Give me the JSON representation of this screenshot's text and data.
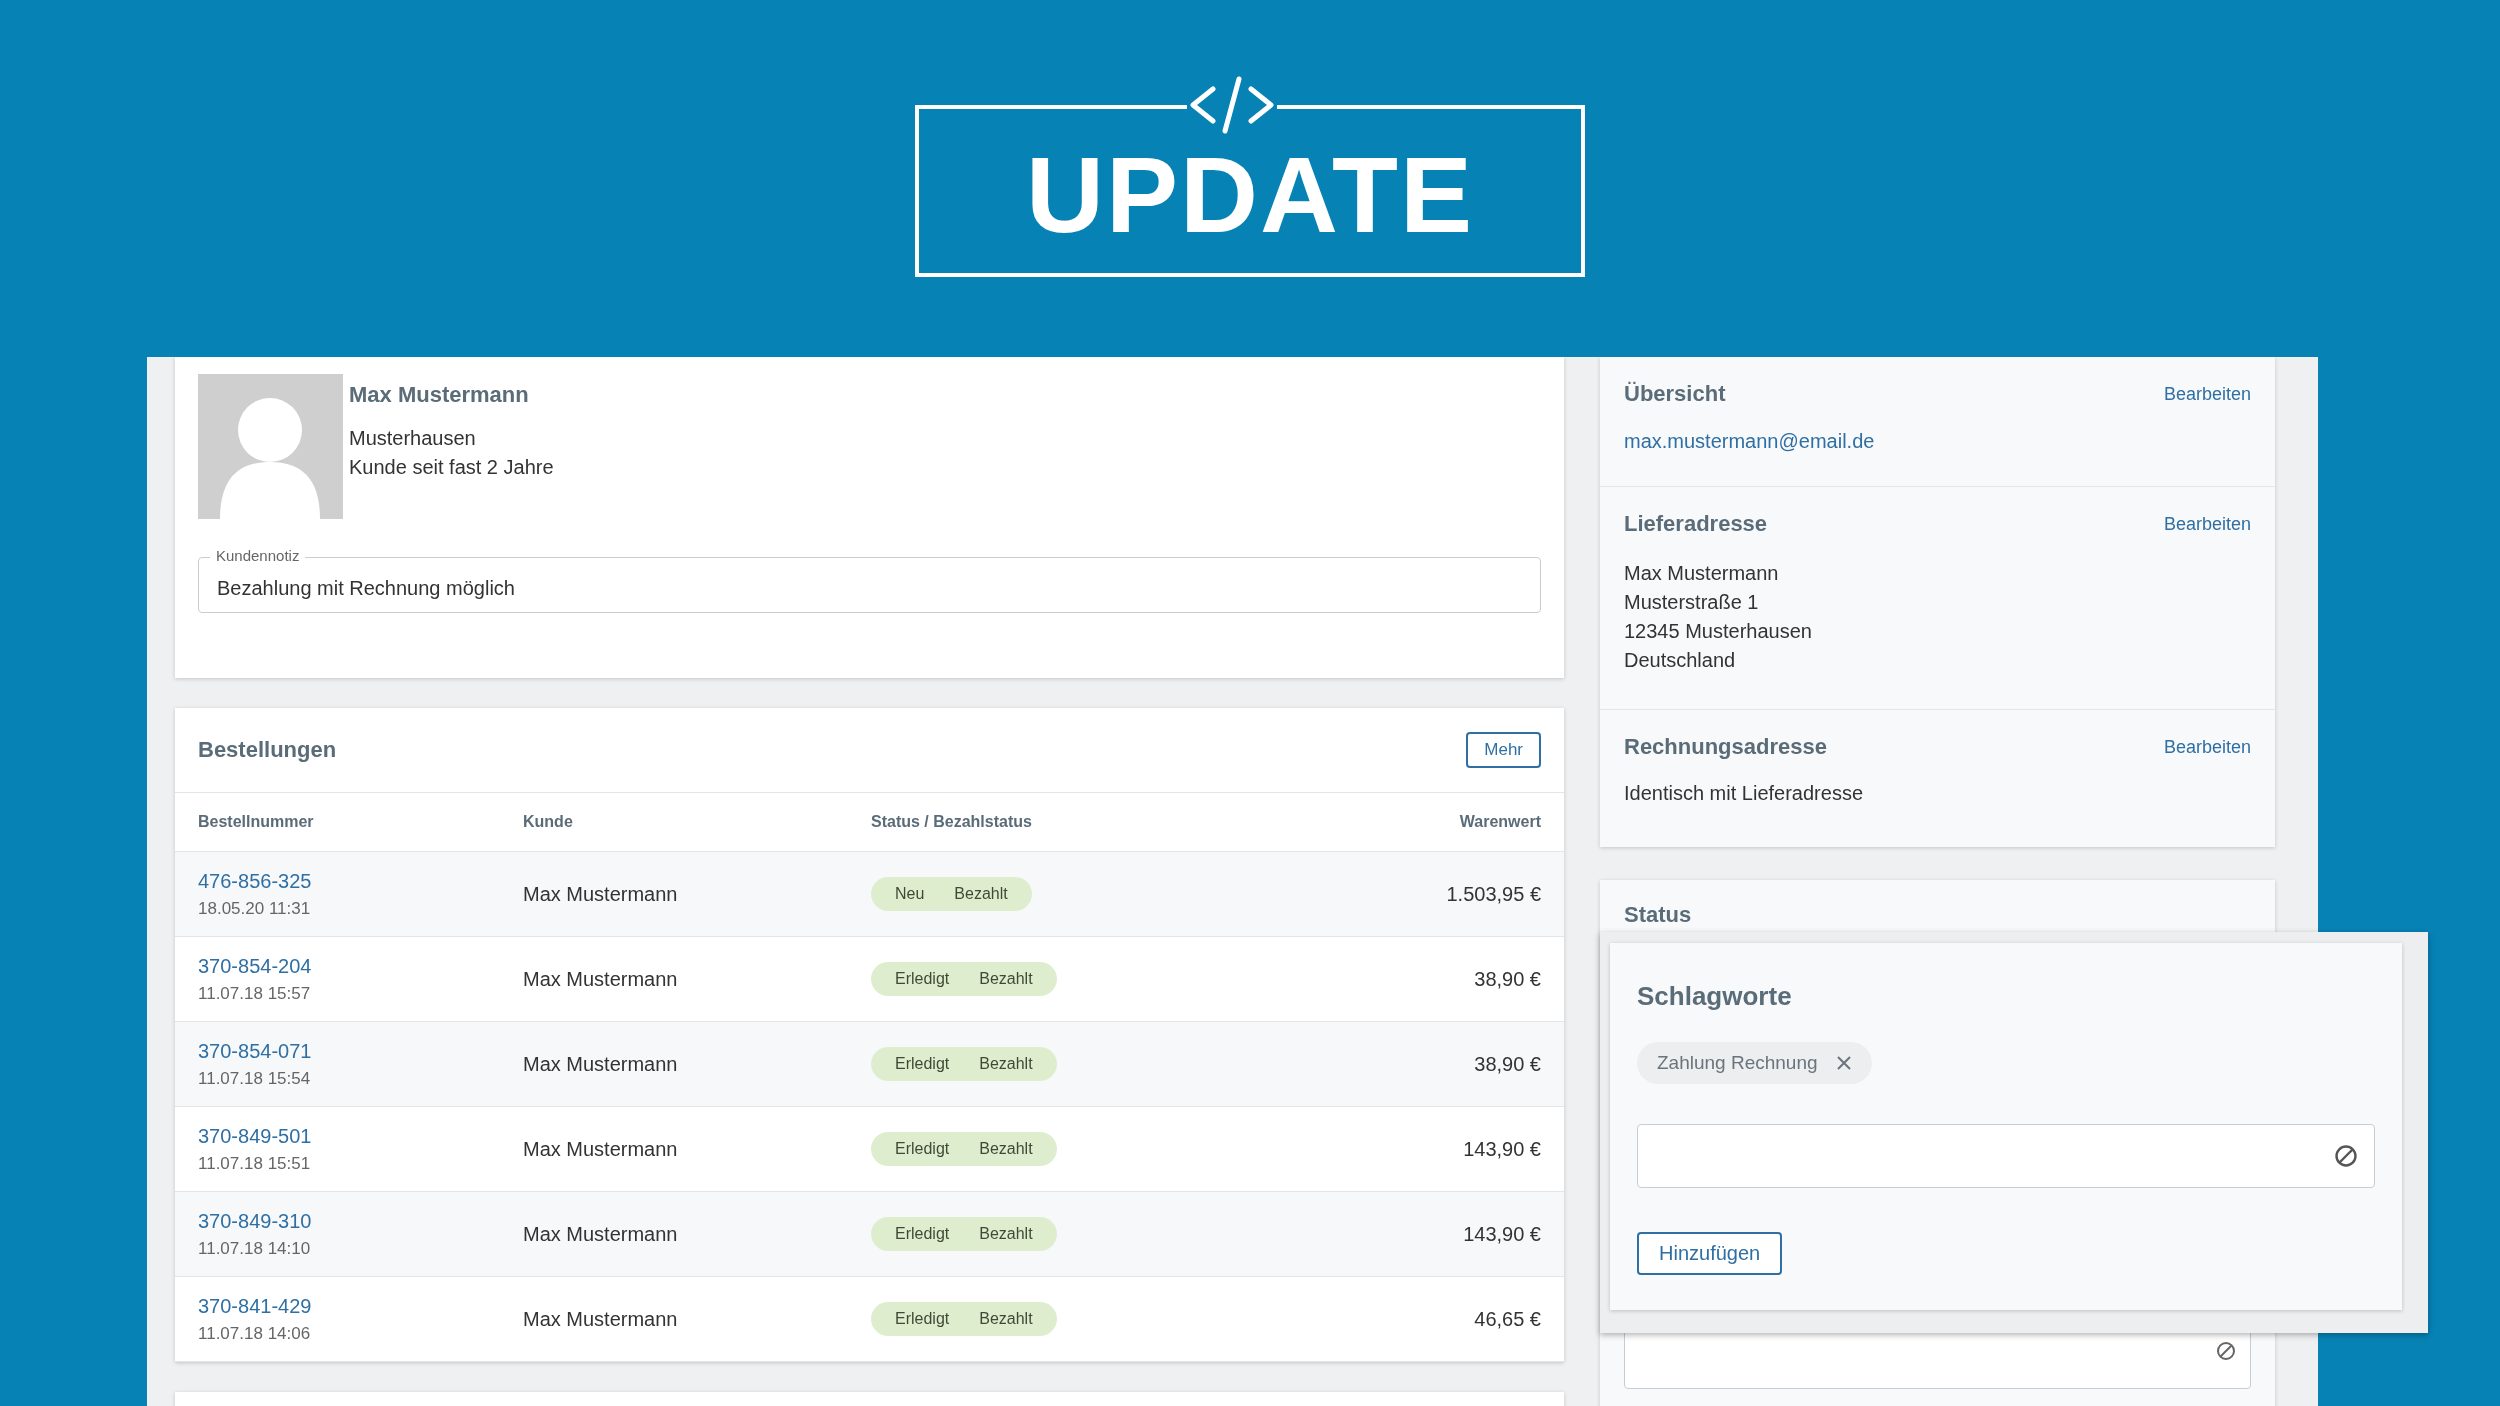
{
  "banner": {
    "title": "UPDATE"
  },
  "customer": {
    "name": "Max Mustermann",
    "city": "Musterhausen",
    "since": "Kunde seit fast 2 Jahre",
    "note": {
      "label": "Kundennotiz",
      "value": "Bezahlung mit Rechnung möglich"
    }
  },
  "orders": {
    "title": "Bestellungen",
    "more_button": "Mehr",
    "columns": [
      "Bestellnummer",
      "Kunde",
      "Status / Bezahlstatus",
      "Warenwert"
    ],
    "rows": [
      {
        "number": "476-856-325",
        "date": "18.05.20 11:31",
        "customer": "Max Mustermann",
        "status": "Neu",
        "payment": "Bezahlt",
        "value": "1.503,95 €"
      },
      {
        "number": "370-854-204",
        "date": "11.07.18 15:57",
        "customer": "Max Mustermann",
        "status": "Erledigt",
        "payment": "Bezahlt",
        "value": "38,90 €"
      },
      {
        "number": "370-854-071",
        "date": "11.07.18 15:54",
        "customer": "Max Mustermann",
        "status": "Erledigt",
        "payment": "Bezahlt",
        "value": "38,90 €"
      },
      {
        "number": "370-849-501",
        "date": "11.07.18 15:51",
        "customer": "Max Mustermann",
        "status": "Erledigt",
        "payment": "Bezahlt",
        "value": "143,90 €"
      },
      {
        "number": "370-849-310",
        "date": "11.07.18 14:10",
        "customer": "Max Mustermann",
        "status": "Erledigt",
        "payment": "Bezahlt",
        "value": "143,90 €"
      },
      {
        "number": "370-841-429",
        "date": "11.07.18 14:06",
        "customer": "Max Mustermann",
        "status": "Erledigt",
        "payment": "Bezahlt",
        "value": "46,65 €"
      }
    ]
  },
  "overview": {
    "title": "Übersicht",
    "edit": "Bearbeiten",
    "email": "max.mustermann@email.de"
  },
  "delivery_address": {
    "title": "Lieferadresse",
    "edit": "Bearbeiten",
    "lines": [
      "Max Mustermann",
      "Musterstraße 1",
      "12345 Musterhausen",
      "Deutschland"
    ]
  },
  "billing_address": {
    "title": "Rechnungsadresse",
    "edit": "Bearbeiten",
    "text": "Identisch mit Lieferadresse"
  },
  "status": {
    "title": "Status"
  },
  "tags_dialog": {
    "title": "Schlagworte",
    "tags": [
      {
        "label": "Zahlung Rechnung"
      }
    ],
    "add_button": "Hinzufügen"
  }
}
